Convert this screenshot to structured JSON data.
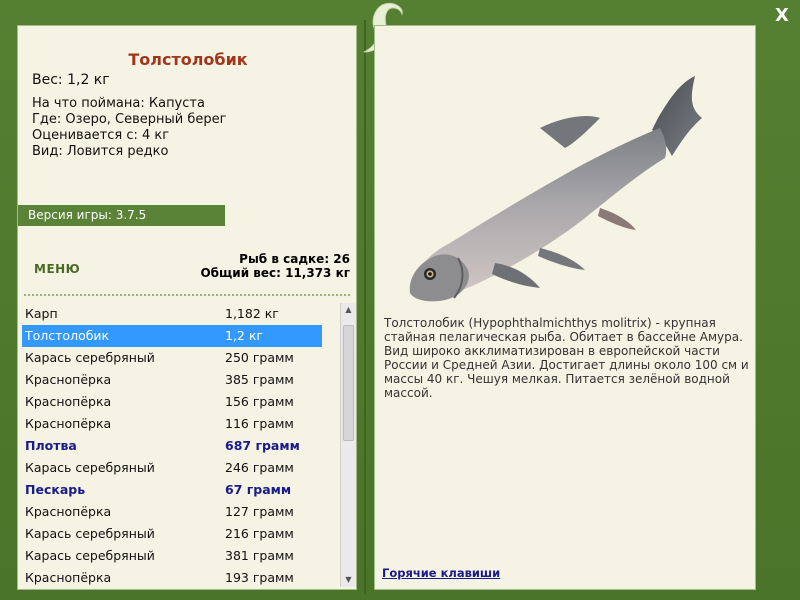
{
  "close_label": "X",
  "fish": {
    "title": "Толстолобик",
    "weight_line": "Вес: 1,2 кг",
    "bait_line": "На что поймана: Капуста",
    "place_line": "Где: Озеро, Северный берег",
    "value_line": "Оценивается с: 4 кг",
    "type_line": "Вид: Ловится редко",
    "description": "Толстолобик (Hypophthalmichthys molitrix) - крупная стайная пелагическая рыба. Обитает в бассейне Амура. Вид широко акклиматизирован в европейской части России и Средней Азии. Достигает длины около 100 см и массы 40 кг. Чешуя мелкая. Питается зелёной водной массой."
  },
  "version_label": "Версия игры: 3.7.5",
  "menu_label": "МЕНЮ",
  "stats": {
    "fish_in_keepnet": "Рыб в садке: 26",
    "total_weight": "Общий вес: 11,373 кг"
  },
  "catch_list": [
    {
      "name": "Карп",
      "weight": "1,182 кг",
      "style": "normal"
    },
    {
      "name": "Толстолобик",
      "weight": "1,2 кг",
      "style": "selected"
    },
    {
      "name": "Карась серебряный",
      "weight": "250 грамм",
      "style": "normal"
    },
    {
      "name": "Краснопёрка",
      "weight": "385 грамм",
      "style": "normal"
    },
    {
      "name": "Краснопёрка",
      "weight": "156 грамм",
      "style": "normal"
    },
    {
      "name": "Краснопёрка",
      "weight": "116 грамм",
      "style": "normal"
    },
    {
      "name": "Плотва",
      "weight": "687 грамм",
      "style": "highlight"
    },
    {
      "name": "Карась серебряный",
      "weight": "246 грамм",
      "style": "normal"
    },
    {
      "name": "Пескарь",
      "weight": "67 грамм",
      "style": "highlight"
    },
    {
      "name": "Краснопёрка",
      "weight": "127 грамм",
      "style": "normal"
    },
    {
      "name": "Карась серебряный",
      "weight": "216 грамм",
      "style": "normal"
    },
    {
      "name": "Карась серебряный",
      "weight": "381 грамм",
      "style": "normal"
    },
    {
      "name": "Краснопёрка",
      "weight": "193 грамм",
      "style": "normal"
    }
  ],
  "hotkeys_label": "Горячие клавиши",
  "colors": {
    "frame_green": "#4f7a2e",
    "panel_bg": "#f5f3e4",
    "title_red": "#a2361b",
    "selected_blue": "#3399ff",
    "highlight_navy": "#1a1a8a"
  }
}
